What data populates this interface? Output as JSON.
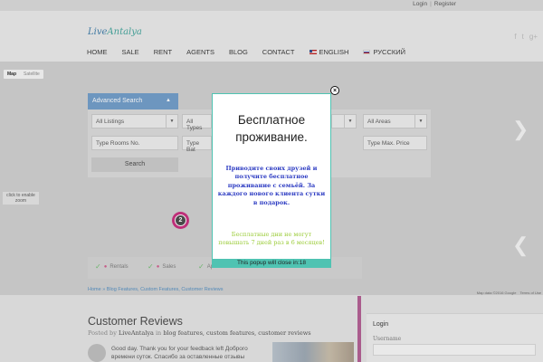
{
  "topbar": {
    "login": "Login",
    "separator": "|",
    "register": "Register"
  },
  "header": {
    "logo_part1": "Live",
    "logo_part2": "Antalya",
    "socials": [
      "facebook-icon",
      "twitter-icon",
      "google-plus-icon"
    ],
    "social_glyphs": [
      "f",
      "t",
      "g+"
    ]
  },
  "nav": {
    "items": [
      "HOME",
      "SALE",
      "RENT",
      "AGENTS",
      "BLOG",
      "CONTACT"
    ],
    "english": "ENGLISH",
    "russian": "РУССКИЙ"
  },
  "map": {
    "types": [
      "Map",
      "Satellite"
    ],
    "zoom_hint": "click to enable zoom",
    "marker_count": "2",
    "footer": [
      "Map data ©2016 Google",
      "Terms of Use"
    ]
  },
  "search": {
    "tab_label": "Advanced Search",
    "listings": "All Listings",
    "types": "All Types",
    "areas": "All Areas",
    "rooms_placeholder": "Type Rooms No.",
    "baths_placeholder": "Type Bat",
    "max_price_placeholder": "Type Max. Price",
    "button": "Search"
  },
  "strip": {
    "rentals": "Rentals",
    "sales": "Sales",
    "apartments": "Apartments"
  },
  "breadcrumb": "Home » Blog Features, Custom Features, Customer Reviews",
  "post": {
    "title": "Customer Reviews",
    "posted_prefix": "Posted by",
    "author": "LiveAntalya",
    "in": "in",
    "categories": "blog features, custom features, customer reviews",
    "excerpt": "Good day. Thank you for your feedback left Доброго времени суток. Спасибо за оставленные отзывы"
  },
  "sidebar": {
    "heading": "Login",
    "username_label": "Username"
  },
  "popup": {
    "title": "Бесплатное проживание.",
    "text_main": "Приводите своих друзей и получите бесплатное проживание с семьёй. За каждого нового клиента сутки в подарок.",
    "text_note": "Бесплатные дни не могут повышать 7 дней раз в 6 месяцев!",
    "close_prefix": "This popup will close in:",
    "countdown": "18",
    "close_symbol": "×"
  },
  "colors": {
    "accent_teal": "#4fc3b2",
    "search_blue": "#6d9ac8",
    "marker_pink": "#c7287a",
    "popup_blue_text": "#2b3ac2",
    "popup_green_text": "#9ccc3a"
  }
}
